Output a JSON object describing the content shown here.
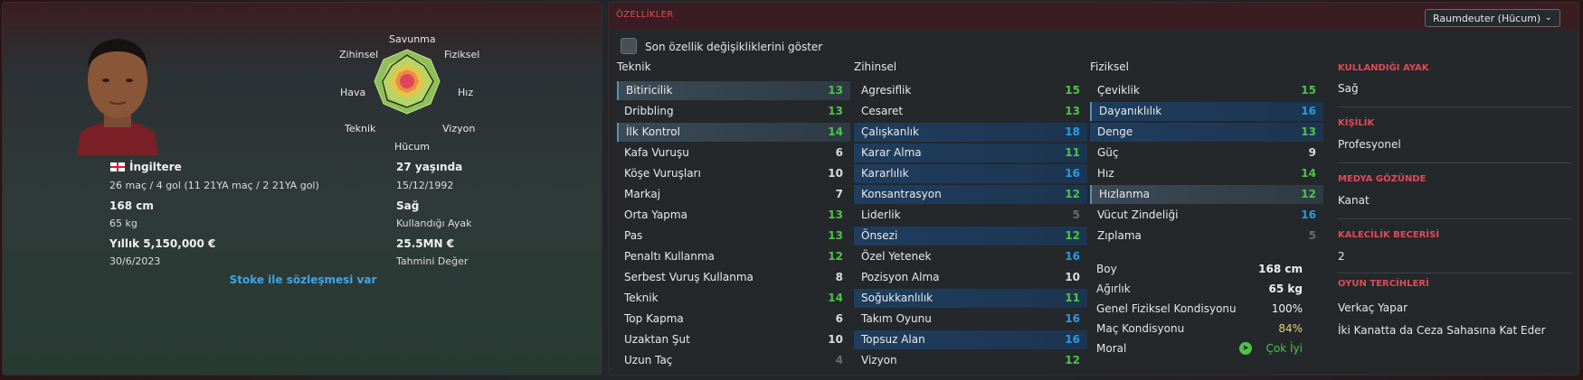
{
  "player": {
    "nationality": "İngiltere",
    "caps_goals": "26 maç / 4 gol (11 21YA maç / 2 21YA gol)",
    "height": "168 cm",
    "weight": "65 kg",
    "wage": "Yıllık 5,150,000 €",
    "contract_end": "30/6/2023",
    "age": "27 yaşında",
    "dob": "15/12/1992",
    "foot": "Sağ",
    "foot_label": "Kullandığı Ayak",
    "value": "25.5MN €",
    "value_label": "Tahmini Değer",
    "contract_note": "Stoke ile sözleşmesi var"
  },
  "radar": {
    "labels": {
      "top": "Savunma",
      "tl": "Zihinsel",
      "tr": "Fiziksel",
      "l": "Hava",
      "r": "Hız",
      "bl": "Teknik",
      "br": "Vizyon",
      "bottom": "Hücum"
    }
  },
  "panel": {
    "title": "ÖZELLİKLER",
    "role": "Raumdeuter (Hücum)",
    "show_changes": "Son özellik değişikliklerini göster"
  },
  "columns": {
    "technical": {
      "title": "Teknik",
      "rows": [
        {
          "name": "Bitiricilik",
          "value": "13"
        },
        {
          "name": "Dribbling",
          "value": "13"
        },
        {
          "name": "İlk Kontrol",
          "value": "14"
        },
        {
          "name": "Kafa Vuruşu",
          "value": "6"
        },
        {
          "name": "Köşe Vuruşları",
          "value": "10"
        },
        {
          "name": "Markaj",
          "value": "7"
        },
        {
          "name": "Orta Yapma",
          "value": "13"
        },
        {
          "name": "Pas",
          "value": "13"
        },
        {
          "name": "Penaltı Kullanma",
          "value": "12"
        },
        {
          "name": "Serbest Vuruş Kullanma",
          "value": "8"
        },
        {
          "name": "Teknik",
          "value": "14"
        },
        {
          "name": "Top Kapma",
          "value": "6"
        },
        {
          "name": "Uzaktan Şut",
          "value": "10"
        },
        {
          "name": "Uzun Taç",
          "value": "4"
        }
      ]
    },
    "mental": {
      "title": "Zihinsel",
      "rows": [
        {
          "name": "Agresiflik",
          "value": "15"
        },
        {
          "name": "Cesaret",
          "value": "13"
        },
        {
          "name": "Çalışkanlık",
          "value": "18"
        },
        {
          "name": "Karar Alma",
          "value": "11"
        },
        {
          "name": "Kararlılık",
          "value": "16"
        },
        {
          "name": "Konsantrasyon",
          "value": "12"
        },
        {
          "name": "Liderlik",
          "value": "5"
        },
        {
          "name": "Önsezi",
          "value": "12"
        },
        {
          "name": "Özel Yetenek",
          "value": "16"
        },
        {
          "name": "Pozisyon Alma",
          "value": "10"
        },
        {
          "name": "Soğukkanlılık",
          "value": "11"
        },
        {
          "name": "Takım Oyunu",
          "value": "16"
        },
        {
          "name": "Topsuz Alan",
          "value": "16"
        },
        {
          "name": "Vizyon",
          "value": "12"
        }
      ]
    },
    "physical": {
      "title": "Fiziksel",
      "rows": [
        {
          "name": "Çeviklik",
          "value": "15"
        },
        {
          "name": "Dayanıklılık",
          "value": "16"
        },
        {
          "name": "Denge",
          "value": "13"
        },
        {
          "name": "Güç",
          "value": "9"
        },
        {
          "name": "Hız",
          "value": "14"
        },
        {
          "name": "Hızlanma",
          "value": "12"
        },
        {
          "name": "Vücut Zindeliği",
          "value": "16"
        },
        {
          "name": "Zıplama",
          "value": "5"
        }
      ]
    }
  },
  "summary": [
    {
      "label": "Boy",
      "value": "168 cm"
    },
    {
      "label": "Ağırlık",
      "value": "65 kg"
    },
    {
      "label": "Genel Fiziksel Kondisyonu",
      "value": "100%"
    },
    {
      "label": "Maç Kondisyonu",
      "value": "84%"
    },
    {
      "label": "Moral",
      "value": "Çok İyi"
    }
  ],
  "side": [
    {
      "heading": "KULLANDIĞI AYAK",
      "value": "Sağ"
    },
    {
      "heading": "KİŞİLİK",
      "value": "Profesyonel"
    },
    {
      "heading": "MEDYA GÖZÜNDE",
      "value": "Kanat"
    },
    {
      "heading": "KALECİLİK BECERİSİ",
      "value": "2"
    },
    {
      "heading": "OYUN TERCİHLERİ",
      "value": "Verkaç Yapar",
      "value2": "İki Kanatta da Ceza Sahasına Kat Eder"
    }
  ],
  "colors": {
    "accent": "#e04a55",
    "green": "#4fc24a",
    "blue": "#2b9ae0",
    "grey": "#6a6a6a",
    "yellow": "#e8d27a"
  }
}
